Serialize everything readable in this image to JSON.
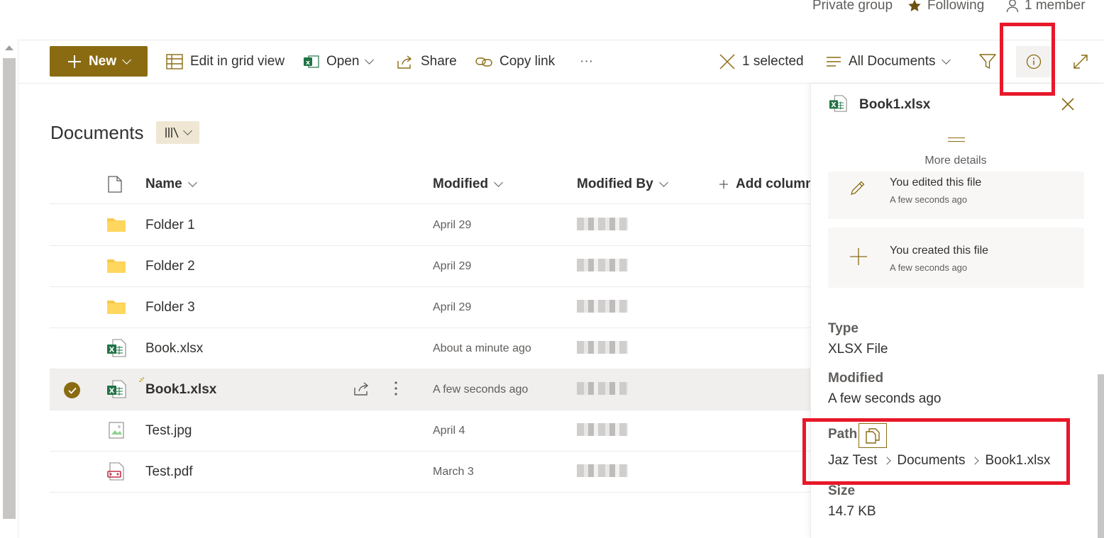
{
  "group": {
    "privacy": "Private group",
    "following": "Following",
    "members": "1 member"
  },
  "toolbar": {
    "new_label": "New",
    "edit_grid": "Edit in grid view",
    "open": "Open",
    "share": "Share",
    "copy_link": "Copy link",
    "more": "···",
    "selected": "1 selected",
    "view": "All Documents"
  },
  "library": {
    "title": "Documents",
    "columns": {
      "name": "Name",
      "modified": "Modified",
      "modified_by": "Modified By",
      "add_column": "Add column"
    },
    "rows": [
      {
        "name": "Folder 1",
        "modified": "April 29",
        "type": "folder"
      },
      {
        "name": "Folder 2",
        "modified": "April 29",
        "type": "folder"
      },
      {
        "name": "Folder 3",
        "modified": "April 29",
        "type": "folder"
      },
      {
        "name": "Book.xlsx",
        "modified": "About a minute ago",
        "type": "xlsx"
      },
      {
        "name": "Book1.xlsx",
        "modified": "A few seconds ago",
        "type": "xlsx",
        "selected": true
      },
      {
        "name": "Test.jpg",
        "modified": "April 4",
        "type": "image"
      },
      {
        "name": "Test.pdf",
        "modified": "March 3",
        "type": "pdf"
      }
    ]
  },
  "details": {
    "file_name": "Book1.xlsx",
    "more_details": "More details",
    "activity": [
      {
        "title": "You edited this file",
        "time": "A few seconds ago",
        "icon": "pencil-icon"
      },
      {
        "title": "You created this file",
        "time": "A few seconds ago",
        "icon": "plus-icon"
      }
    ],
    "type_label": "Type",
    "type_value": "XLSX File",
    "modified_label": "Modified",
    "modified_value": "A few seconds ago",
    "path_label": "Path",
    "path": [
      "Jaz Test",
      "Documents",
      "Book1.xlsx"
    ],
    "size_label": "Size",
    "size_value": "14.7 KB"
  },
  "colors": {
    "accent": "#8a6b12",
    "highlight": "#e8182a",
    "excel": "#217346"
  }
}
